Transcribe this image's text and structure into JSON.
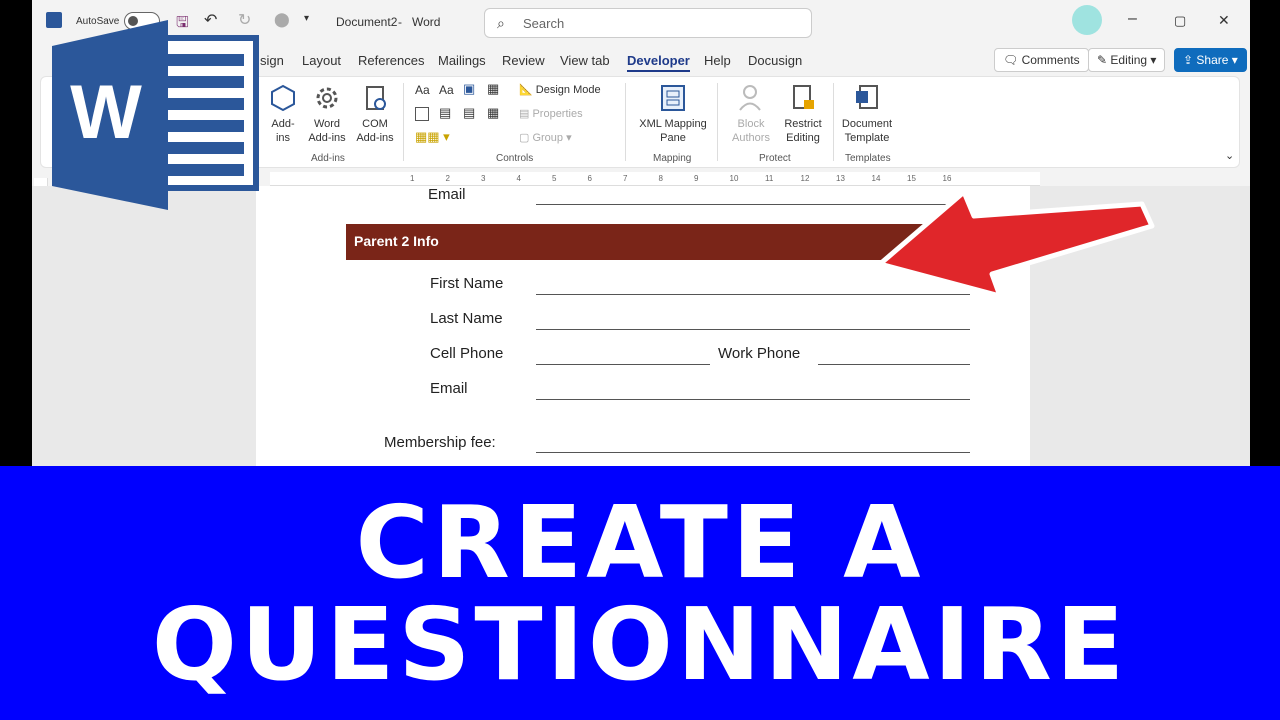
{
  "titlebar": {
    "autosave_label": "AutoSave",
    "doc_title": "Document2",
    "app_name": "Word",
    "search_placeholder": "Search",
    "minimize": "–",
    "restore": "▢",
    "close": "✕"
  },
  "tabs": {
    "items": [
      "sign",
      "Layout",
      "References",
      "Mailings",
      "Review",
      "View tab",
      "Developer",
      "Help",
      "Docusign"
    ],
    "active": "Developer"
  },
  "actions": {
    "comments": "Comments",
    "editing": "Editing",
    "share": "Share"
  },
  "ribbon": {
    "addins_label": "Add-ins",
    "addins_group_btn1": "Add-\nins",
    "word_addins": "Word Add-ins",
    "com_addins": "COM Add-ins",
    "controls_label": "Controls",
    "design_mode": "Design Mode",
    "properties": "Properties",
    "group": "Group",
    "xml_mapping": "XML Mapping Pane",
    "mapping_label": "Mapping",
    "block_authors": "Block Authors",
    "restrict_editing": "Restrict Editing",
    "protect_label": "Protect",
    "document_template": "Document Template",
    "templates_label": "Templates",
    "aa1": "Aa",
    "aa2": "Aa"
  },
  "ruler": {
    "ticks": [
      "1",
      "2",
      "3",
      "4",
      "5",
      "6",
      "7",
      "8",
      "9",
      "10",
      "11",
      "12",
      "13",
      "14",
      "15",
      "16"
    ]
  },
  "document": {
    "email_top": "Email",
    "section_title": "Parent 2 Info",
    "first_name": "First Name",
    "last_name": "Last Name",
    "cell_phone": "Cell Phone",
    "work_phone": "Work Phone",
    "email": "Email",
    "membership_fee": "Membership fee:"
  },
  "logo": {
    "letter": "W"
  },
  "banner": {
    "line1": "CREATE A",
    "line2": "QUESTIONNAIRE"
  },
  "colors": {
    "banner_bg": "#0000ff",
    "section_bar": "#7a2518",
    "arrow": "#e0262a",
    "word_blue": "#2b579a"
  }
}
